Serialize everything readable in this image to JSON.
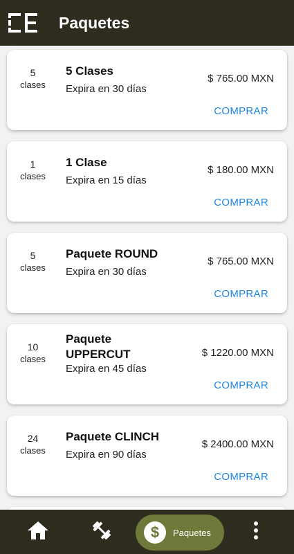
{
  "app_bar": {
    "title": "Paquetes",
    "logo_icon": "CE"
  },
  "packages": [
    {
      "count": "5",
      "unit": "clases",
      "name": "5 Clases",
      "expiry": "Expira en 30 días",
      "price": "$ 765.00 MXN",
      "action": "COMPRAR"
    },
    {
      "count": "1",
      "unit": "clases",
      "name": "1 Clase",
      "expiry": "Expira en 15 días",
      "price": "$ 180.00 MXN",
      "action": "COMPRAR"
    },
    {
      "count": "5",
      "unit": "clases",
      "name": "Paquete ROUND",
      "expiry": "Expira en 30 días",
      "price": "$ 765.00 MXN",
      "action": "COMPRAR"
    },
    {
      "count": "10",
      "unit": "clases",
      "name": "Paquete UPPERCUT",
      "expiry": "Expira en 45 días",
      "price": "$ 1220.00 MXN",
      "action": "COMPRAR"
    },
    {
      "count": "24",
      "unit": "clases",
      "name": "Paquete CLINCH",
      "expiry": "Expira en 90 días",
      "price": "$ 2400.00 MXN",
      "action": "COMPRAR"
    }
  ],
  "bottom_nav": {
    "items": [
      {
        "icon": "home-icon"
      },
      {
        "icon": "dumbbell-icon"
      },
      {
        "icon": "dollar-icon",
        "label": "Paquetes",
        "active": true
      },
      {
        "icon": "more-vertical-icon"
      }
    ]
  },
  "colors": {
    "bar": "#2d2c1f",
    "active": "#6f7a3a",
    "link": "#1e88e5"
  }
}
